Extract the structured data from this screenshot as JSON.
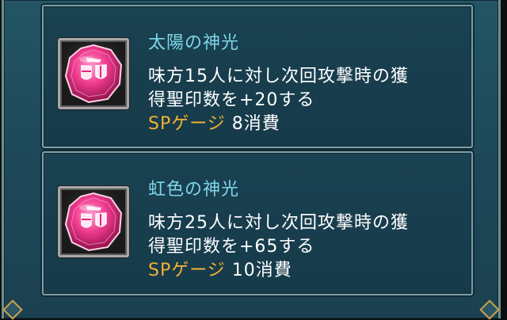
{
  "skills": [
    {
      "name": "太陽の神光",
      "desc_line1": "味方15人に対し次回攻撃時の獲",
      "desc_line2": "得聖印数を+20する",
      "sp_label": "SPゲージ",
      "sp_value": "8消費",
      "icon": "pink-crystal-gem-icon"
    },
    {
      "name": "虹色の神光",
      "desc_line1": "味方25人に対し次回攻撃時の獲",
      "desc_line2": "得聖印数を+65する",
      "sp_label": "SPゲージ",
      "sp_value": "10消費",
      "icon": "pink-crystal-gem-icon"
    }
  ],
  "colors": {
    "skill_name": "#7fd6e8",
    "sp_label": "#f2b134",
    "text": "#ffffff",
    "gem": "#e8267c"
  }
}
